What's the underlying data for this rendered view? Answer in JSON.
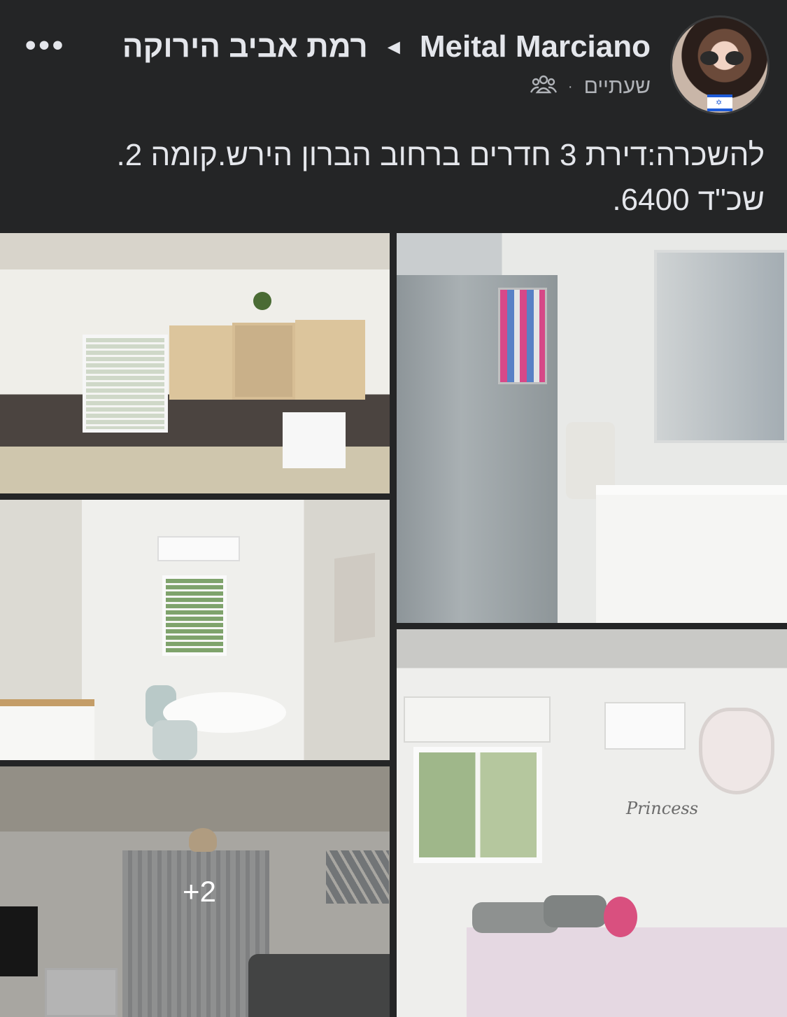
{
  "post": {
    "author": "Meital Marciano",
    "arrow": "◄",
    "group": "רמת אביב הירוקה",
    "time": "שעתיים",
    "separator": "·",
    "audience_icon": "group-icon",
    "more_label": "•••",
    "text_line1": "להשכרה:דירת 3 חדרים ברחוב הברון הירש.קומה 2.",
    "text_line2": "שכ\"ד 6400."
  },
  "avatar": {
    "flag_icon": "israel-flag-icon",
    "flag_star": "✡"
  },
  "photos": {
    "items": [
      {
        "scene": "kitchen"
      },
      {
        "scene": "bathroom"
      },
      {
        "scene": "dining-area"
      },
      {
        "scene": "bedroom",
        "sign_text": "Princess"
      },
      {
        "scene": "living-room",
        "more_count": "+2"
      }
    ]
  },
  "colors": {
    "background": "#242526",
    "text_primary": "#e4e6eb",
    "text_secondary": "#b0b3b8"
  }
}
